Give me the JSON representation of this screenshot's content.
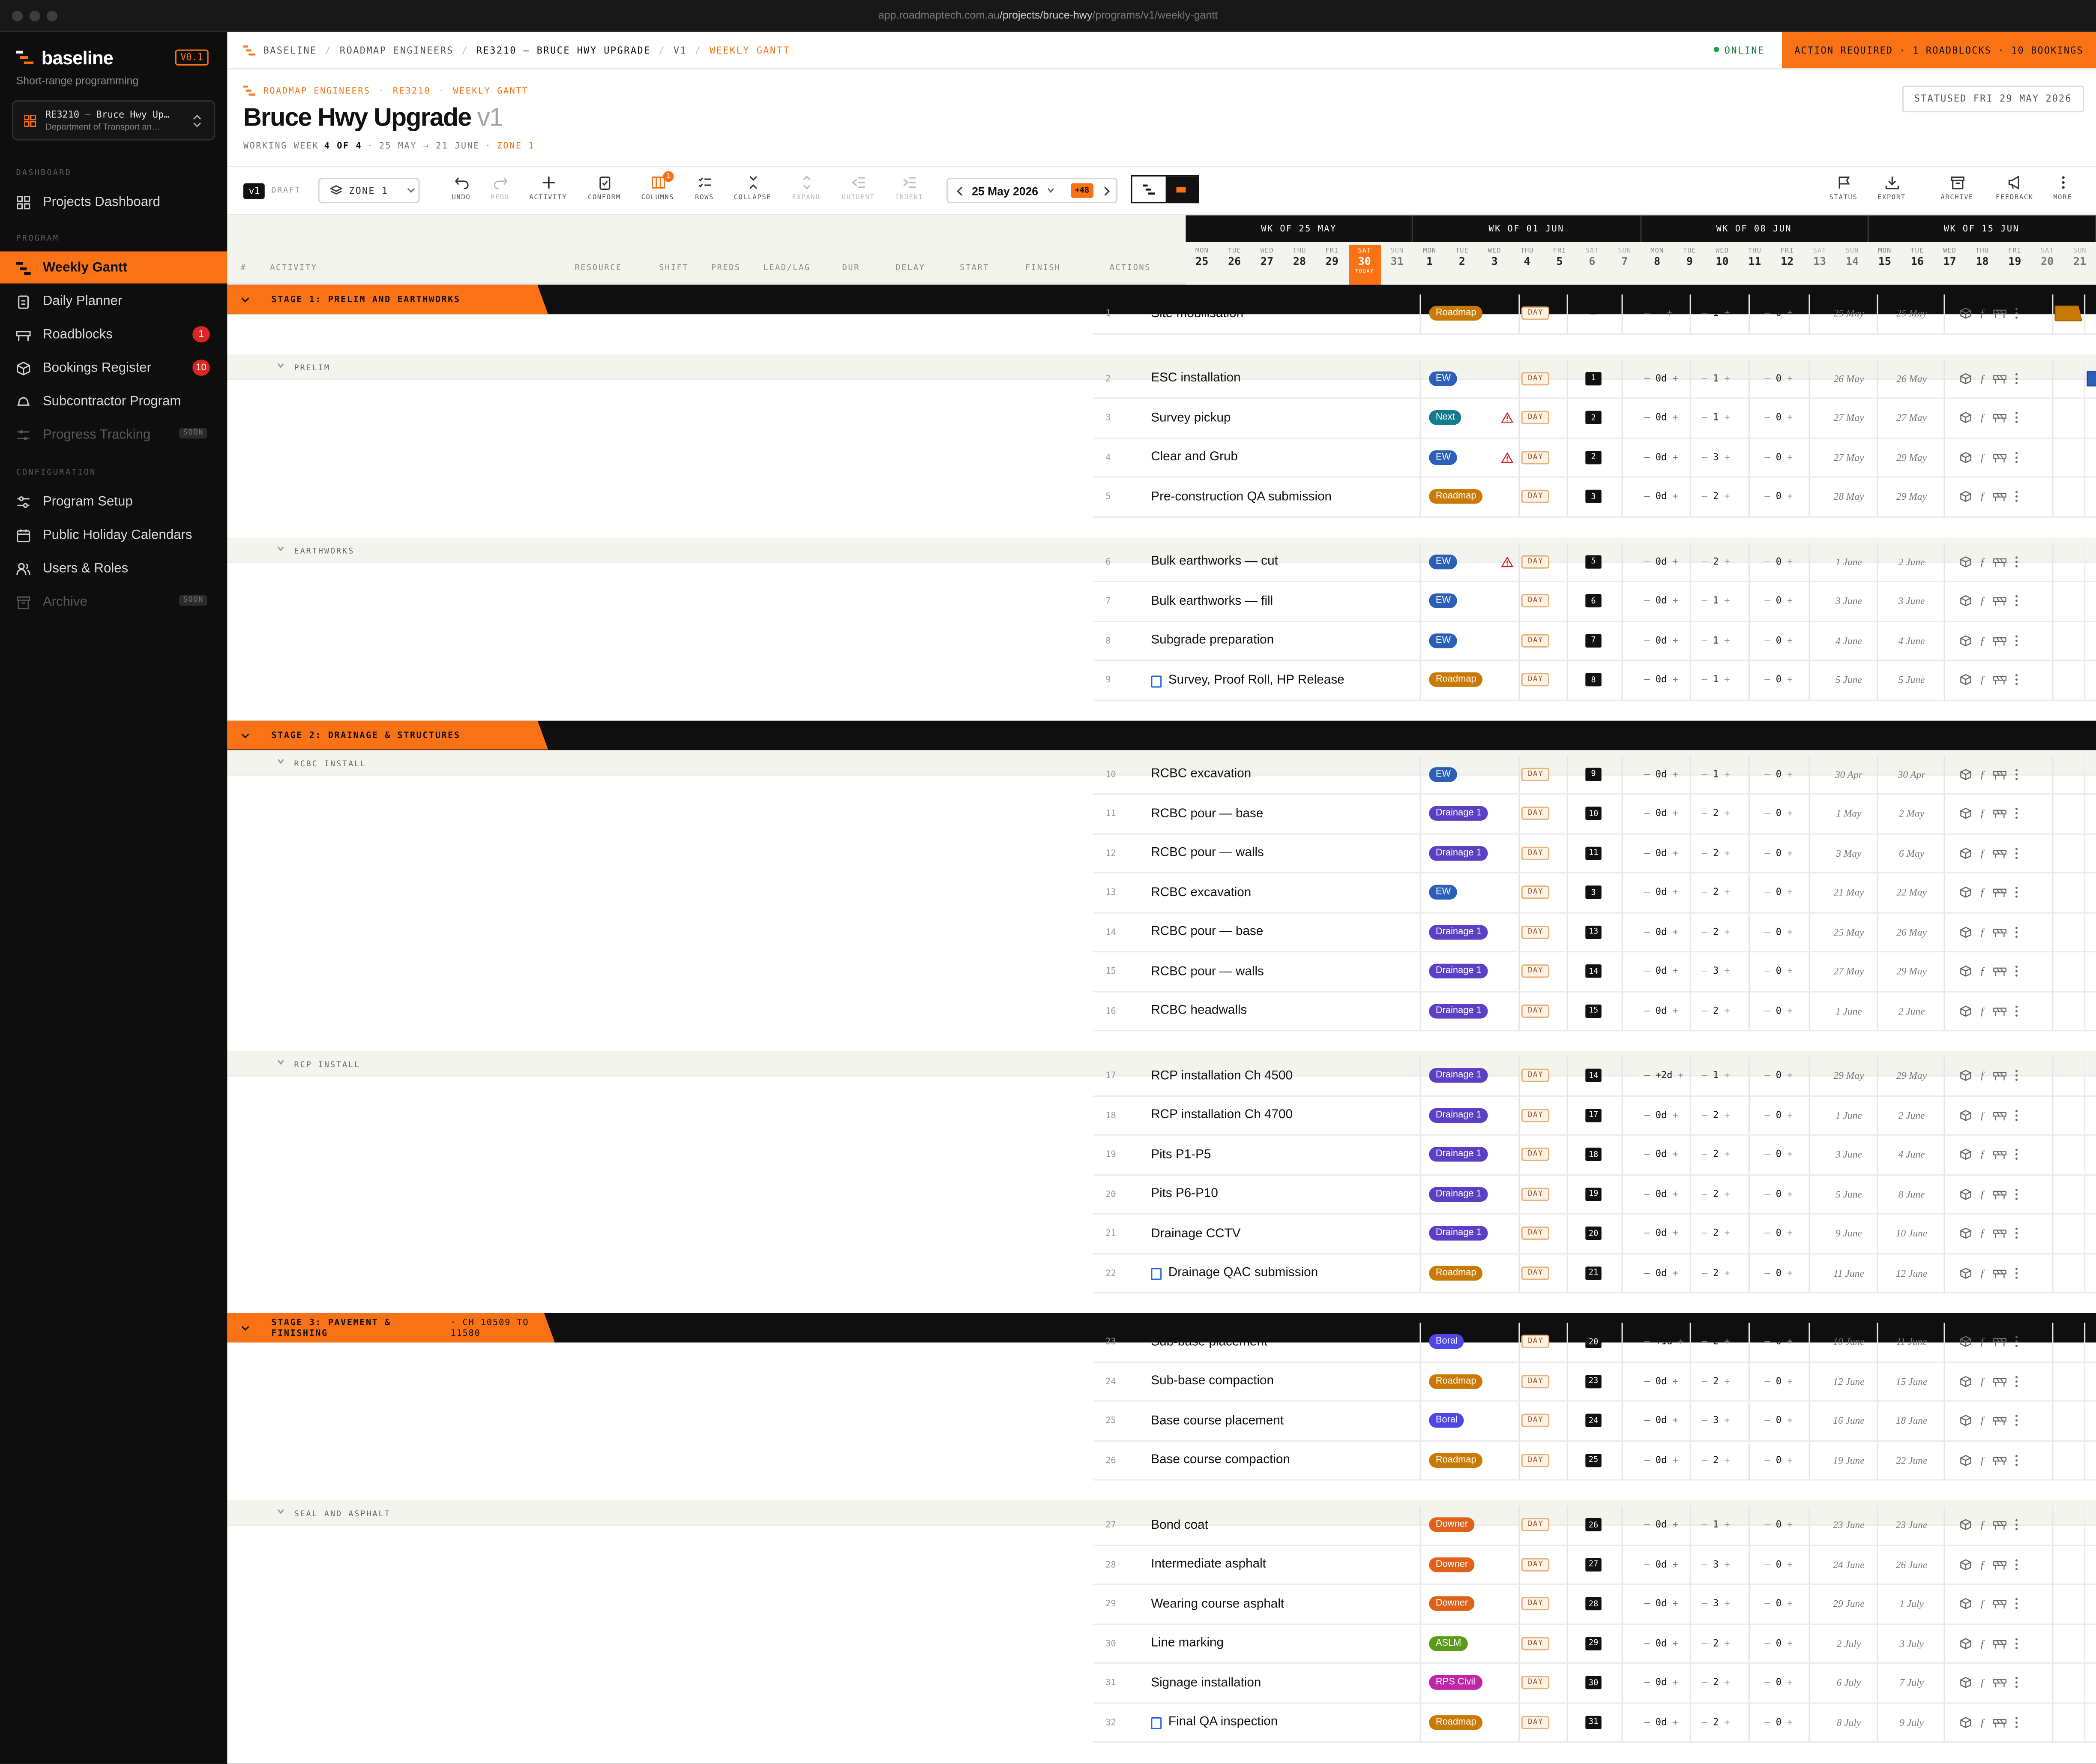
{
  "browser": {
    "url_prefix": "app.roadmaptech.com.au",
    "url_path": "/projects/bruce-hwy",
    "url_suffix": "/programs/v1/weekly-gantt"
  },
  "sidebar": {
    "brand": "baseline",
    "version": "V0.1",
    "tagline": "Short-range programming",
    "project_name": "RE3210 — Bruce Hwy Up…",
    "project_dept": "Department of Transport an…",
    "section_dashboard": "DASHBOARD",
    "section_program": "PROGRAM",
    "section_config": "CONFIGURATION",
    "items": [
      {
        "label": "Projects Dashboard",
        "icon": "grid-icon"
      },
      {
        "label": "Weekly Gantt",
        "icon": "gantt-icon",
        "active": true
      },
      {
        "label": "Daily Planner",
        "icon": "clipboard-icon"
      },
      {
        "label": "Roadblocks",
        "icon": "barrier-icon",
        "badge": "1"
      },
      {
        "label": "Bookings Register",
        "icon": "cube-icon",
        "badge": "10"
      },
      {
        "label": "Subcontractor Program",
        "icon": "hardhat-icon"
      },
      {
        "label": "Progress Tracking",
        "icon": "sliders-icon",
        "soon": "SOON"
      },
      {
        "label": "Program Setup",
        "icon": "settings-sliders-icon"
      },
      {
        "label": "Public Holiday Calendars",
        "icon": "calendar-icon"
      },
      {
        "label": "Users & Roles",
        "icon": "users-icon"
      },
      {
        "label": "Archive",
        "icon": "archive-icon",
        "soon": "SOON"
      }
    ]
  },
  "topbar": {
    "crumbs": [
      "BASELINE",
      "ROADMAP ENGINEERS",
      "RE3210 — BRUCE HWY UPGRADE",
      "V1",
      "WEEKLY GANTT"
    ],
    "online": "ONLINE",
    "action_required": "ACTION REQUIRED · 1 ROADBLOCKS · 10 BOOKINGS"
  },
  "header": {
    "crumbs": [
      "ROADMAP ENGINEERS",
      "RE3210",
      "WEEKLY GANTT"
    ],
    "title": "Bruce Hwy Upgrade",
    "title_version": "v1",
    "working_week_label": "WORKING WEEK",
    "working_week_value": "4 OF 4",
    "date_range": "25 MAY → 21 JUNE",
    "zone": "ZONE 1",
    "statused": "STATUSED FRI 29 MAY 2026"
  },
  "toolbar": {
    "version": "v1",
    "draft": "DRAFT",
    "zone_select": "ZONE 1",
    "buttons": [
      "UNDO",
      "REDO",
      "ACTIVITY",
      "CONFORM",
      "COLUMNS",
      "ROWS",
      "COLLAPSE",
      "EXPAND",
      "OUTDENT",
      "INDENT"
    ],
    "columns_badge": "1",
    "date": "25 May 2026",
    "date_offset": "+48",
    "right_buttons": [
      "STATUS",
      "EXPORT",
      "ARCHIVE",
      "FEEDBACK",
      "MORE"
    ]
  },
  "columns": [
    "#",
    "ACTIVITY",
    "RESOURCE",
    "SHIFT",
    "PREDS",
    "LEAD/LAG",
    "DUR",
    "DELAY",
    "START",
    "FINISH",
    "ACTIONS"
  ],
  "weeks": [
    "WK OF 25 MAY",
    "WK OF 01 JUN",
    "WK OF 08 JUN",
    "WK OF 15 JUN"
  ],
  "days": [
    {
      "d": "MON",
      "n": "25"
    },
    {
      "d": "TUE",
      "n": "26"
    },
    {
      "d": "WED",
      "n": "27"
    },
    {
      "d": "THU",
      "n": "28"
    },
    {
      "d": "FRI",
      "n": "29"
    },
    {
      "d": "SAT",
      "n": "30",
      "today": "TODAY"
    },
    {
      "d": "SUN",
      "n": "31"
    },
    {
      "d": "MON",
      "n": "1"
    },
    {
      "d": "TUE",
      "n": "2"
    },
    {
      "d": "WED",
      "n": "3"
    },
    {
      "d": "THU",
      "n": "4"
    },
    {
      "d": "FRI",
      "n": "5"
    },
    {
      "d": "SAT",
      "n": "6"
    },
    {
      "d": "SUN",
      "n": "7"
    },
    {
      "d": "MON",
      "n": "8"
    },
    {
      "d": "TUE",
      "n": "9"
    },
    {
      "d": "WED",
      "n": "10"
    },
    {
      "d": "THU",
      "n": "11"
    },
    {
      "d": "FRI",
      "n": "12"
    },
    {
      "d": "SAT",
      "n": "13"
    },
    {
      "d": "SUN",
      "n": "14"
    },
    {
      "d": "MON",
      "n": "15"
    },
    {
      "d": "TUE",
      "n": "16"
    },
    {
      "d": "WED",
      "n": "17"
    },
    {
      "d": "THU",
      "n": "18"
    },
    {
      "d": "FRI",
      "n": "19"
    },
    {
      "d": "SAT",
      "n": "20"
    },
    {
      "d": "SUN",
      "n": "21"
    }
  ],
  "resource_colors": {
    "Roadmap": "#c97a06",
    "EW": "#2b5fb8",
    "Next": "#137a8f",
    "Drainage 1": "#5b3fc4",
    "Boral": "#4f46e5",
    "Downer": "#e0611a",
    "ASLM": "#5b9a1a",
    "RPS Civil": "#c026a8"
  },
  "shift_label": "DAY",
  "rows": [
    {
      "t": "stage",
      "label": "STAGE 1: PRELIM AND EARTHWORKS"
    },
    {
      "t": "act",
      "n": "1",
      "name": "Site mobilisation",
      "res": "Roadmap",
      "pred": "—",
      "ll": "—",
      "dur": "1",
      "dly": "0",
      "start": "25 May",
      "finish": "25 May",
      "bar": [
        0,
        1,
        "rm"
      ]
    },
    {
      "t": "group",
      "label": "PRELIM"
    },
    {
      "t": "act",
      "n": "2",
      "name": "ESC installation",
      "res": "EW",
      "pred": "1",
      "ll": "0d",
      "dur": "1",
      "dly": "0",
      "start": "26 May",
      "finish": "26 May",
      "bar": [
        1,
        1,
        "ew"
      ]
    },
    {
      "t": "act",
      "n": "3",
      "name": "Survey pickup",
      "res": "Next",
      "warn": true,
      "pred": "2",
      "ll": "0d",
      "dur": "1",
      "dly": "0",
      "start": "27 May",
      "finish": "27 May",
      "bar": [
        2,
        1,
        "nx"
      ]
    },
    {
      "t": "act",
      "n": "4",
      "name": "Clear and Grub",
      "res": "EW",
      "warn": true,
      "pred": "2",
      "ll": "0d",
      "dur": "3",
      "dly": "0",
      "start": "27 May",
      "finish": "29 May",
      "bar": [
        2,
        3,
        "ew"
      ]
    },
    {
      "t": "act",
      "n": "5",
      "name": "Pre-construction QA submission",
      "res": "Roadmap",
      "pred": "3",
      "ll": "0d",
      "dur": "2",
      "dly": "0",
      "start": "28 May",
      "finish": "29 May",
      "bar": [
        3,
        2,
        "rm"
      ]
    },
    {
      "t": "group",
      "label": "EARTHWORKS"
    },
    {
      "t": "act",
      "n": "6",
      "name": "Bulk earthworks — cut",
      "res": "EW",
      "warn": true,
      "pred": "5",
      "ll": "0d",
      "dur": "2",
      "dly": "0",
      "start": "1 June",
      "finish": "2 June",
      "bar": [
        7,
        1.5,
        "ew"
      ]
    },
    {
      "t": "act",
      "n": "7",
      "name": "Bulk earthworks — fill",
      "res": "EW",
      "pred": "6",
      "ll": "0d",
      "dur": "1",
      "dly": "0",
      "start": "3 June",
      "finish": "3 June",
      "bar": [
        9,
        0.6,
        "ew"
      ]
    },
    {
      "t": "act",
      "n": "8",
      "name": "Subgrade preparation",
      "res": "EW",
      "pred": "7",
      "ll": "0d",
      "dur": "1",
      "dly": "0",
      "start": "4 June",
      "finish": "4 June",
      "bar": [
        10,
        0.5,
        "ew"
      ]
    },
    {
      "t": "act",
      "n": "9",
      "name": "Survey, Proof Roll, HP Release",
      "res": "Roadmap",
      "chk": true,
      "pred": "8",
      "ll": "0d",
      "dur": "1",
      "dly": "0",
      "start": "5 June",
      "finish": "5 June",
      "bar": [
        11,
        0.4,
        "rm"
      ]
    },
    {
      "t": "stage",
      "label": "STAGE 2: DRAINAGE & STRUCTURES"
    },
    {
      "t": "group",
      "label": "RCBC INSTALL"
    },
    {
      "t": "act",
      "n": "10",
      "name": "RCBC excavation",
      "res": "EW",
      "pred": "9",
      "ll": "0d",
      "dur": "1",
      "dly": "0",
      "start": "30 Apr",
      "finish": "30 Apr"
    },
    {
      "t": "act",
      "n": "11",
      "name": "RCBC pour — base",
      "res": "Drainage 1",
      "pred": "10",
      "ll": "0d",
      "dur": "2",
      "dly": "0",
      "start": "1 May",
      "finish": "2 May"
    },
    {
      "t": "act",
      "n": "12",
      "name": "RCBC pour — walls",
      "res": "Drainage 1",
      "pred": "11",
      "ll": "0d",
      "dur": "2",
      "dly": "0",
      "start": "3 May",
      "finish": "6 May"
    },
    {
      "t": "act",
      "n": "13",
      "name": "RCBC excavation",
      "res": "EW",
      "pred": "3",
      "ll": "0d",
      "dur": "2",
      "dly": "0",
      "start": "21 May",
      "finish": "22 May"
    },
    {
      "t": "act",
      "n": "14",
      "name": "RCBC pour — base",
      "res": "Drainage 1",
      "pred": "13",
      "ll": "0d",
      "dur": "2",
      "dly": "0",
      "start": "25 May",
      "finish": "26 May"
    },
    {
      "t": "act",
      "n": "15",
      "name": "RCBC pour — walls",
      "res": "Drainage 1",
      "pred": "14",
      "ll": "0d",
      "dur": "3",
      "dly": "0",
      "start": "27 May",
      "finish": "29 May"
    },
    {
      "t": "act",
      "n": "16",
      "name": "RCBC headwalls",
      "res": "Drainage 1",
      "pred": "15",
      "ll": "0d",
      "dur": "2",
      "dly": "0",
      "start": "1 June",
      "finish": "2 June"
    },
    {
      "t": "group",
      "label": "RCP INSTALL"
    },
    {
      "t": "act",
      "n": "17",
      "name": "RCP installation Ch 4500",
      "res": "Drainage 1",
      "pred": "14",
      "ll": "+2d",
      "dur": "1",
      "dly": "0",
      "start": "29 May",
      "finish": "29 May"
    },
    {
      "t": "act",
      "n": "18",
      "name": "RCP installation Ch 4700",
      "res": "Drainage 1",
      "pred": "17",
      "ll": "0d",
      "dur": "2",
      "dly": "0",
      "start": "1 June",
      "finish": "2 June"
    },
    {
      "t": "act",
      "n": "19",
      "name": "Pits P1-P5",
      "res": "Drainage 1",
      "pred": "18",
      "ll": "0d",
      "dur": "2",
      "dly": "0",
      "start": "3 June",
      "finish": "4 June"
    },
    {
      "t": "act",
      "n": "20",
      "name": "Pits P6-P10",
      "res": "Drainage 1",
      "pred": "19",
      "ll": "0d",
      "dur": "2",
      "dly": "0",
      "start": "5 June",
      "finish": "8 June"
    },
    {
      "t": "act",
      "n": "21",
      "name": "Drainage CCTV",
      "res": "Drainage 1",
      "pred": "20",
      "ll": "0d",
      "dur": "2",
      "dly": "0",
      "start": "9 June",
      "finish": "10 June"
    },
    {
      "t": "act",
      "n": "22",
      "name": "Drainage QAC submission",
      "res": "Roadmap",
      "chk": true,
      "pred": "21",
      "ll": "0d",
      "dur": "2",
      "dly": "0",
      "start": "11 June",
      "finish": "12 June"
    },
    {
      "t": "stage",
      "label": "STAGE 3: PAVEMENT & FINISHING",
      "sub": "· CH 10509 TO 11580"
    },
    {
      "t": "act",
      "n": "23",
      "name": "Sub-base placement",
      "res": "Boral",
      "pred": "20",
      "ll": "+1d",
      "dur": "2",
      "dly": "0",
      "start": "10 June",
      "finish": "11 June"
    },
    {
      "t": "act",
      "n": "24",
      "name": "Sub-base compaction",
      "res": "Roadmap",
      "pred": "23",
      "ll": "0d",
      "dur": "2",
      "dly": "0",
      "start": "12 June",
      "finish": "15 June"
    },
    {
      "t": "act",
      "n": "25",
      "name": "Base course placement",
      "res": "Boral",
      "pred": "24",
      "ll": "0d",
      "dur": "3",
      "dly": "0",
      "start": "16 June",
      "finish": "18 June"
    },
    {
      "t": "act",
      "n": "26",
      "name": "Base course compaction",
      "res": "Roadmap",
      "pred": "25",
      "ll": "0d",
      "dur": "2",
      "dly": "0",
      "start": "19 June",
      "finish": "22 June"
    },
    {
      "t": "group",
      "label": "SEAL AND ASPHALT"
    },
    {
      "t": "act",
      "n": "27",
      "name": "Bond coat",
      "res": "Downer",
      "pred": "26",
      "ll": "0d",
      "dur": "1",
      "dly": "0",
      "start": "23 June",
      "finish": "23 June"
    },
    {
      "t": "act",
      "n": "28",
      "name": "Intermediate asphalt",
      "res": "Downer",
      "pred": "27",
      "ll": "0d",
      "dur": "3",
      "dly": "0",
      "start": "24 June",
      "finish": "26 June"
    },
    {
      "t": "act",
      "n": "29",
      "name": "Wearing course asphalt",
      "res": "Downer",
      "pred": "28",
      "ll": "0d",
      "dur": "3",
      "dly": "0",
      "start": "29 June",
      "finish": "1 July"
    },
    {
      "t": "act",
      "n": "30",
      "name": "Line marking",
      "res": "ASLM",
      "pred": "29",
      "ll": "0d",
      "dur": "2",
      "dly": "0",
      "start": "2 July",
      "finish": "3 July"
    },
    {
      "t": "act",
      "n": "31",
      "name": "Signage installation",
      "res": "RPS Civil",
      "pred": "30",
      "ll": "0d",
      "dur": "2",
      "dly": "0",
      "start": "6 July",
      "finish": "7 July"
    },
    {
      "t": "act",
      "n": "32",
      "name": "Final QA inspection",
      "res": "Roadmap",
      "chk": true,
      "pred": "31",
      "ll": "0d",
      "dur": "2",
      "dly": "0",
      "start": "8 July",
      "finish": "9 July"
    }
  ]
}
